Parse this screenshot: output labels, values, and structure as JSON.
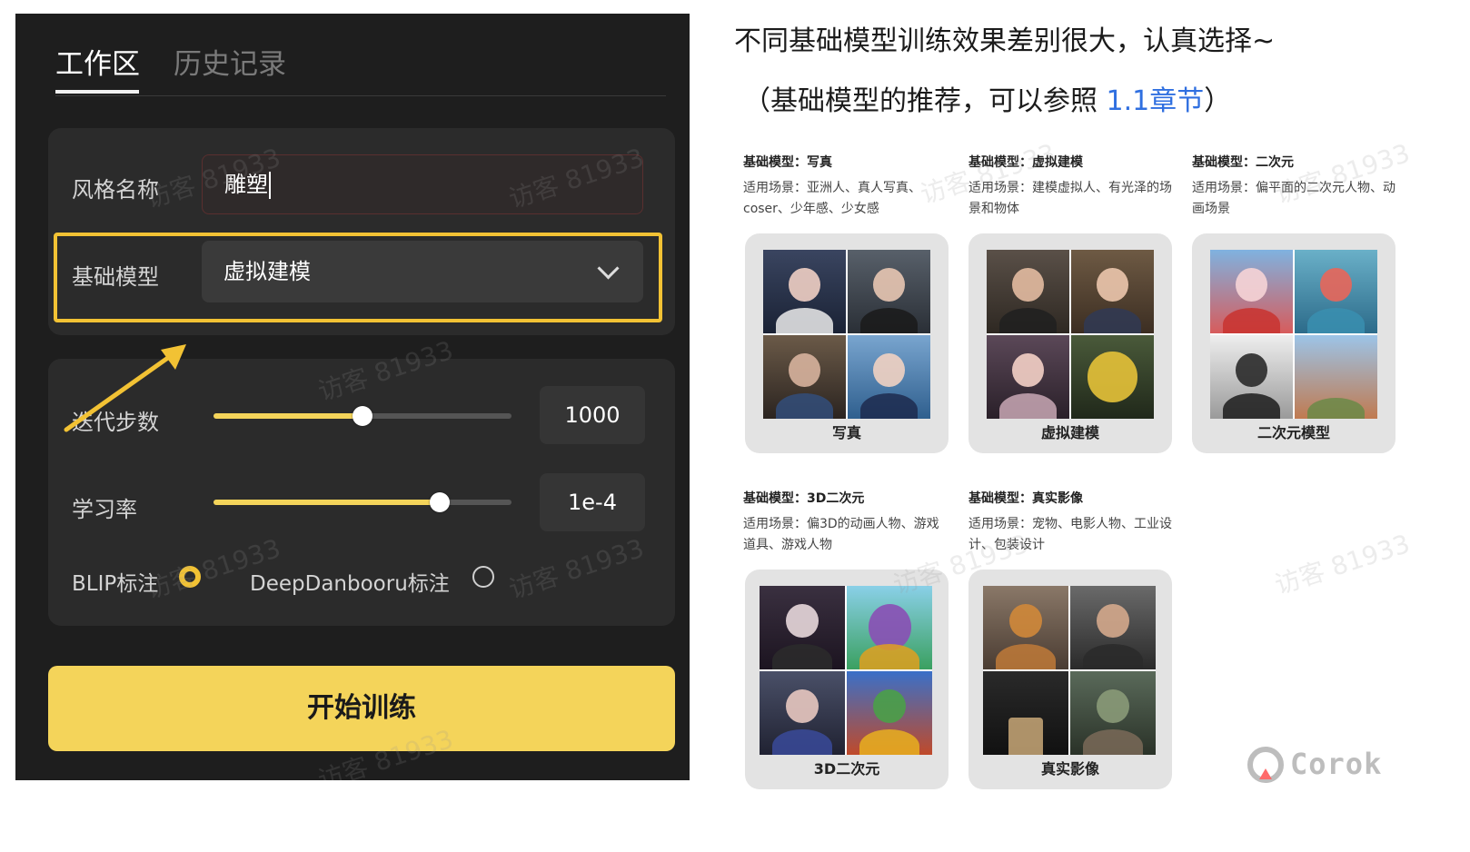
{
  "tabs": [
    {
      "label": "工作区",
      "active": true
    },
    {
      "label": "历史记录",
      "active": false
    }
  ],
  "style_name": {
    "label": "风格名称",
    "value": "雕塑"
  },
  "base_model": {
    "label": "基础模型",
    "value": "虚拟建模",
    "highlight_color": "#f2c234"
  },
  "iterations": {
    "label": "迭代步数",
    "value": "1000",
    "slider_fraction": 0.5
  },
  "learning_rate": {
    "label": "学习率",
    "value": "1e-4",
    "slider_fraction": 0.76
  },
  "annotations": [
    {
      "label": "BLIP标注",
      "selected": true
    },
    {
      "label": "DeepDanbooru标注",
      "selected": false
    }
  ],
  "train_button": "开始训练",
  "watermark": "访客 81933",
  "accent_color": "#f4d45a",
  "right": {
    "headline": "不同基础模型训练效果差别很大，认真选择~",
    "subline_prefix": "（基础模型的推荐，可以参照 ",
    "subline_link": "1.1章节",
    "subline_suffix": "）",
    "models": [
      {
        "title": "基础模型：写真",
        "desc": "适用场景：亚洲人、真人写真、coser、少年感、少女感",
        "label": "写真"
      },
      {
        "title": "基础模型：虚拟建模",
        "desc": "适用场景：建模虚拟人、有光泽的场景和物体",
        "label": "虚拟建模"
      },
      {
        "title": "基础模型：二次元",
        "desc": "适用场景：偏平面的二次元人物、动画场景",
        "label": "二次元模型"
      },
      {
        "title": "基础模型：3D二次元",
        "desc": "适用场景：偏3D的动画人物、游戏道具、游戏人物",
        "label": "3D二次元"
      },
      {
        "title": "基础模型：真实影像",
        "desc": "适用场景：宠物、电影人物、工业设计、包装设计",
        "label": "真实影像"
      }
    ],
    "logo_text": "Corok"
  }
}
